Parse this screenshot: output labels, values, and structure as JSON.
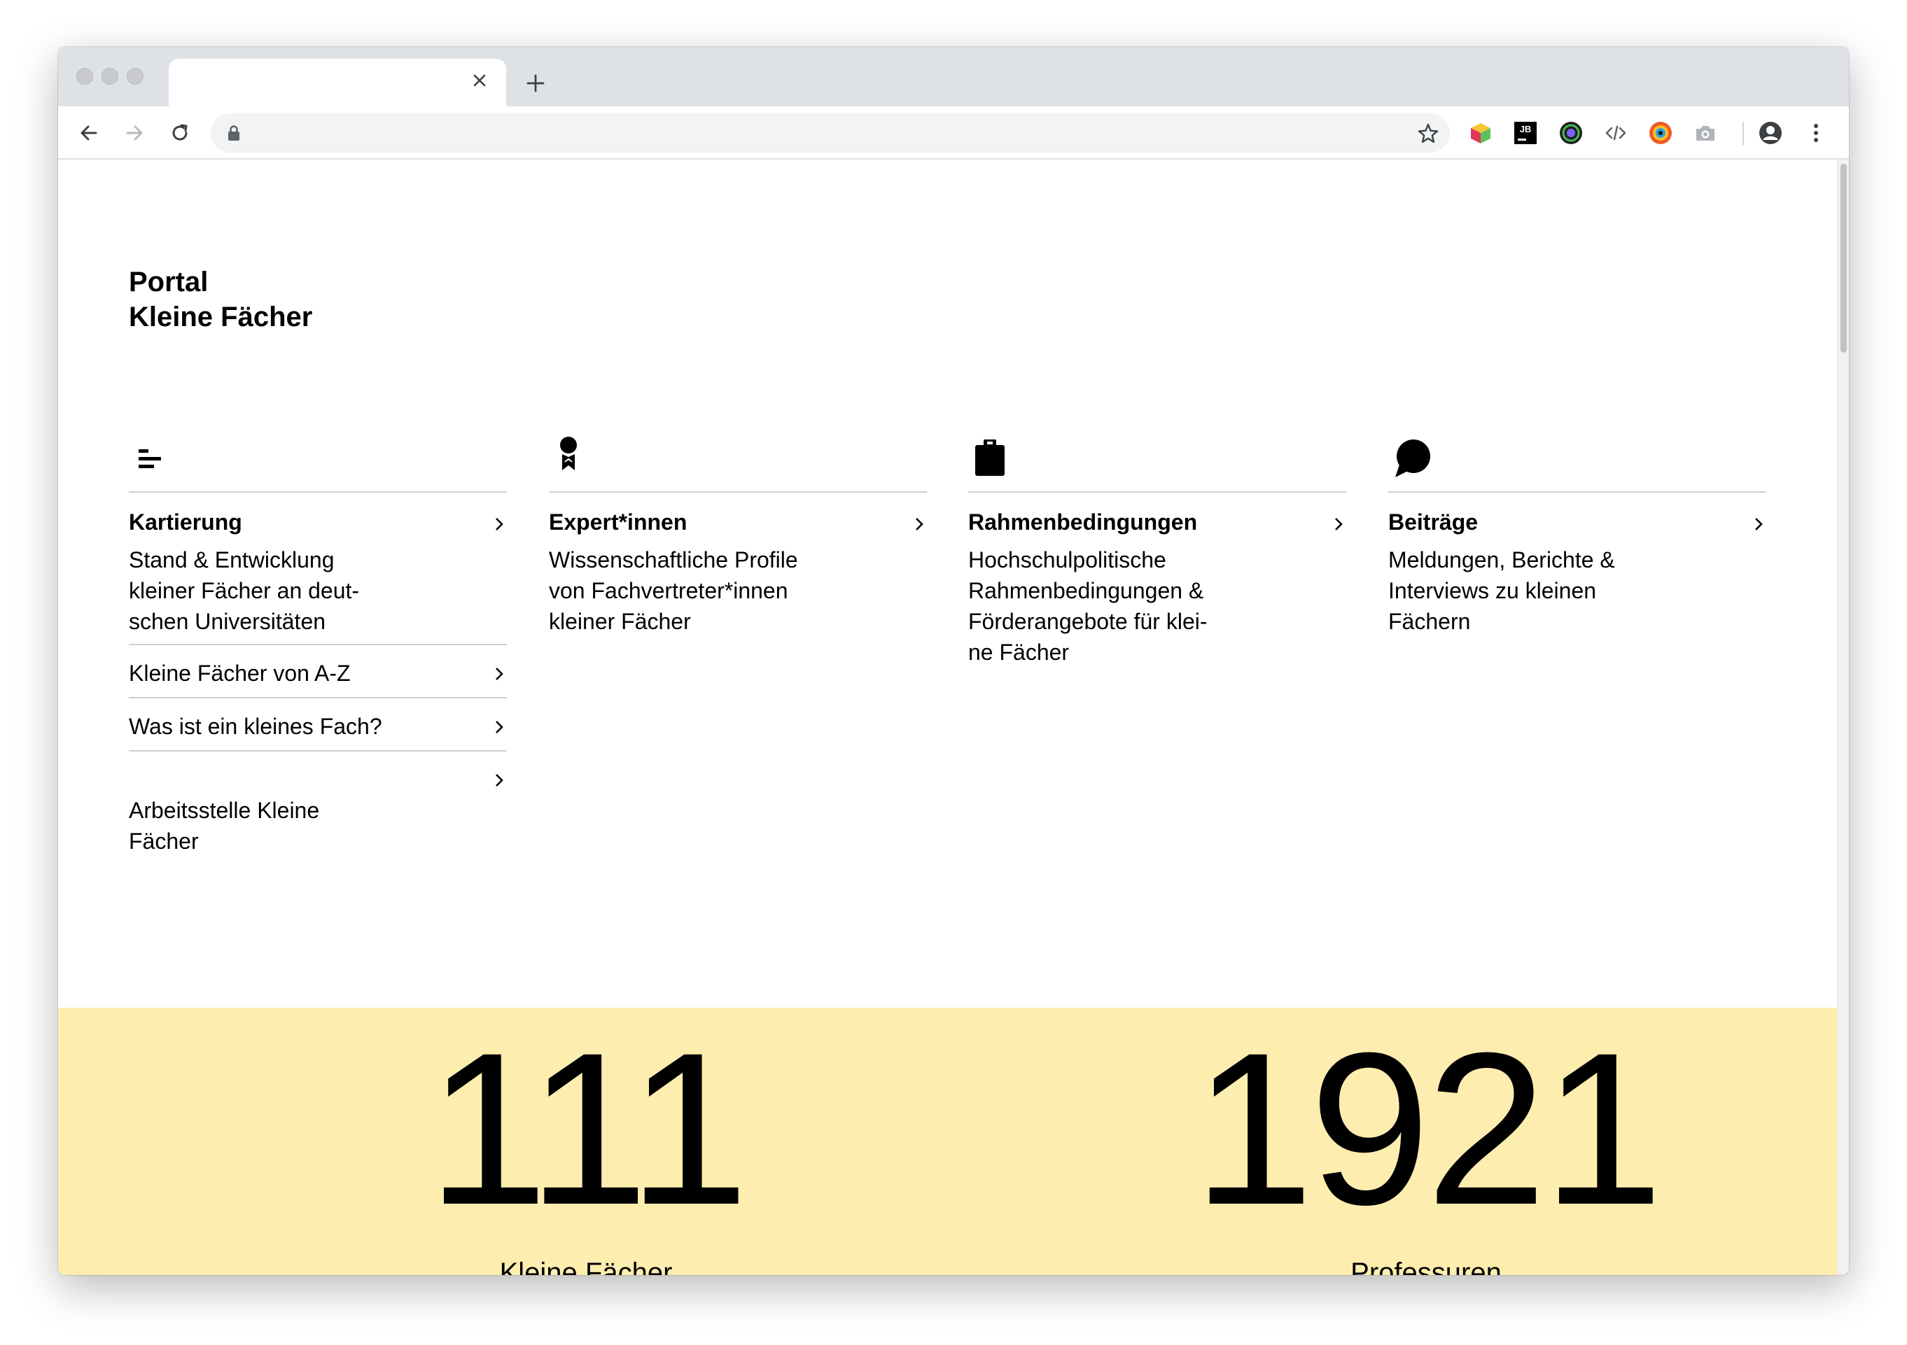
{
  "browser": {
    "tab_close_glyph": "✕",
    "new_tab_glyph": "+",
    "url": "",
    "extensions": [
      "cube-extension-icon",
      "jetbrains-extension-icon",
      "color-picker-icon",
      "code-icon",
      "eye-dropper-icon",
      "camera-icon"
    ]
  },
  "site": {
    "logo_line1": "Portal",
    "logo_line2": "Kleine Fächer"
  },
  "nav_columns": [
    {
      "icon": "list-bars-icon",
      "title": "Kartierung",
      "description": "Stand & Entwicklung\nkleiner Fächer an deut-\nschen Universitäten",
      "sublinks": [
        "Kleine Fächer von A-Z",
        "Was ist ein kleines Fach?",
        "Arbeitsstelle Kleine\nFächer"
      ]
    },
    {
      "icon": "award-badge-icon",
      "title": "Expert*innen",
      "description": "Wissenschaftliche Profile\nvon Fachvertreter*innen\nkleiner Fächer"
    },
    {
      "icon": "clipboard-icon",
      "title": "Rahmenbedingungen",
      "description": "Hochschulpolitische\nRahmenbedingungen &\nFörderangebote für klei-\nne Fächer"
    },
    {
      "icon": "speech-bubble-icon",
      "title": "Beiträge",
      "description": "Meldungen, Berichte &\nInterviews zu kleinen\nFächern"
    }
  ],
  "stats": [
    {
      "value": "111",
      "label": "Kleine Fächer"
    },
    {
      "value": "1921",
      "label": "Professuren"
    }
  ],
  "colors": {
    "stats_background": "#fdeeb0",
    "text": "#000000",
    "rule": "#cfcfcf"
  }
}
